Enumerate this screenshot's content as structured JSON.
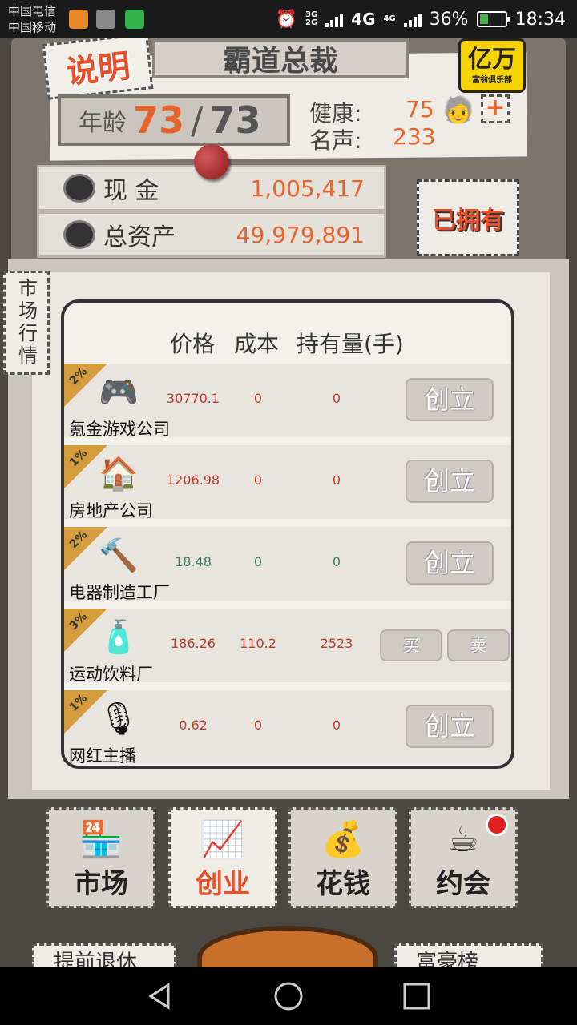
{
  "status_bar": {
    "carrier1": "中国电信",
    "carrier2": "中国移动",
    "net1_top": "3G",
    "net1_bottom": "2G",
    "net2": "4G",
    "net3": "4G",
    "battery": "36%",
    "time": "18:34",
    "icons": [
      "weibo-icon",
      "gallery-icon",
      "wechat-icon",
      "alarm-icon",
      "signal-icon",
      "battery-icon"
    ]
  },
  "header": {
    "intro_label": "说明",
    "title": "霸道总裁",
    "club_badge": {
      "big": "亿万",
      "small": "富翁俱乐部"
    },
    "age_label": "年龄",
    "age_current": "73",
    "age_separator": "/",
    "age_max": "73",
    "health_label": "健康:",
    "health_value": "75",
    "fame_label": "名声:",
    "fame_value": "233",
    "add_health_symbol": "+"
  },
  "money": {
    "cash_label": "现  金",
    "cash_value": "1,005,417",
    "assets_label": "总资产",
    "assets_value": "49,979,891",
    "owned_label": "已拥有"
  },
  "market": {
    "tab_label": "市场行情",
    "columns": {
      "price": "价格",
      "cost": "成本",
      "holding": "持有量(手)"
    },
    "rows": [
      {
        "badge": "2%",
        "icon": "gamepad-icon",
        "icon_glyph": "🎮",
        "name": "氪金游戏公司",
        "price": "30770.1",
        "price_color": "red",
        "cost": "0",
        "holding": "0",
        "action": "创立"
      },
      {
        "badge": "1%",
        "icon": "house-icon",
        "icon_glyph": "🏠",
        "name": "房地产公司",
        "price": "1206.98",
        "price_color": "red",
        "cost": "0",
        "holding": "0",
        "action": "创立"
      },
      {
        "badge": "2%",
        "icon": "appliance-icon",
        "icon_glyph": "🔨",
        "name": "电器制造工厂",
        "price": "18.48",
        "price_color": "green",
        "cost": "0",
        "holding": "0",
        "action": "创立"
      },
      {
        "badge": "3%",
        "icon": "drink-bottle-icon",
        "icon_glyph": "🧴",
        "name": "运动饮料厂",
        "price": "186.26",
        "price_color": "red",
        "cost": "110.2",
        "holding": "2523",
        "buy": "买",
        "sell": "卖"
      },
      {
        "badge": "1%",
        "icon": "microphone-icon",
        "icon_glyph": "🎙",
        "name": "网红主播",
        "price": "0.62",
        "price_color": "red",
        "cost": "0",
        "holding": "0",
        "action": "创立"
      }
    ]
  },
  "nav": {
    "tabs": [
      {
        "label": "市场",
        "icon": "shop-icon",
        "glyph": "🏪"
      },
      {
        "label": "创业",
        "icon": "chart-up-icon",
        "glyph": "📈",
        "active": true
      },
      {
        "label": "花钱",
        "icon": "hand-coins-icon",
        "glyph": "💰"
      },
      {
        "label": "约会",
        "icon": "coffee-heart-icon",
        "glyph": "☕"
      }
    ],
    "peek_left": "提前退休",
    "peek_right": "富豪榜"
  }
}
